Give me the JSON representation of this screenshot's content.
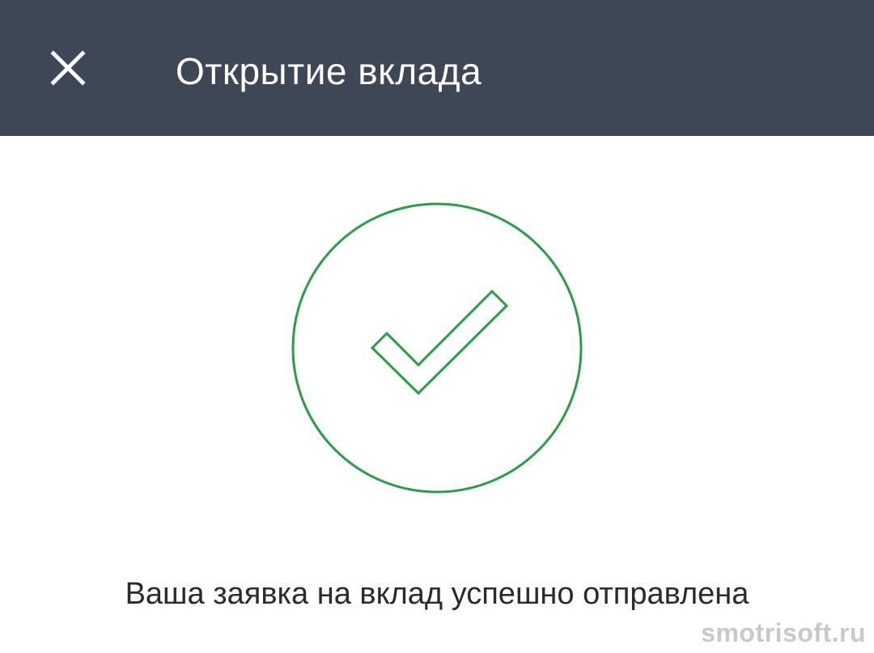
{
  "header": {
    "title": "Открытие вклада",
    "close_icon": "close-icon"
  },
  "main": {
    "status_icon": "checkmark-circle-icon",
    "message": "Ваша заявка на вклад успешно отправлена"
  },
  "watermark": {
    "text": "smotrisoft.ru"
  },
  "colors": {
    "header_background": "#3e4756",
    "accent_green": "#27a045",
    "text_primary": "#2b2b2b",
    "watermark": "#c9c9c9"
  }
}
